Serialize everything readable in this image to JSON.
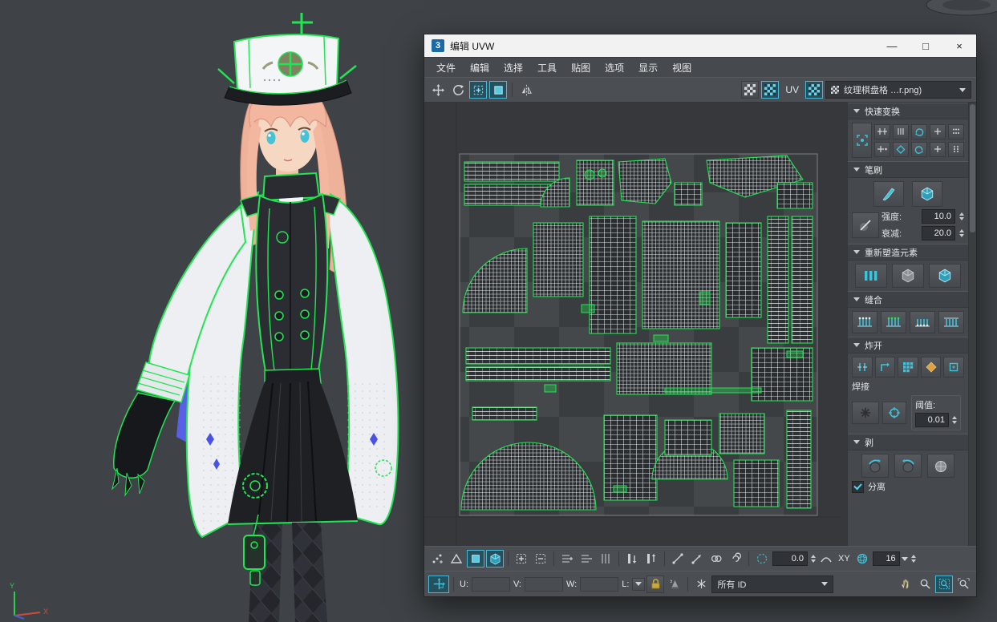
{
  "window": {
    "icon_label": "3",
    "title": "编辑 UVW",
    "minimize": "—",
    "maximize": "□",
    "close": "×"
  },
  "menubar": {
    "items": [
      "文件",
      "编辑",
      "选择",
      "工具",
      "贴图",
      "选项",
      "显示",
      "视图"
    ]
  },
  "toolbar": {
    "uv_label": "UV",
    "texture_name": "纹理棋盘格 …r.png)"
  },
  "panel": {
    "quick_transform": {
      "title": "快速变换"
    },
    "brush": {
      "title": "笔刷",
      "strength_label": "强度:",
      "strength_value": "10.0",
      "falloff_label": "衰减:",
      "falloff_value": "20.0"
    },
    "reshape": {
      "title": "重新塑造元素"
    },
    "stitch": {
      "title": "缝合"
    },
    "explode": {
      "title": "炸开",
      "weld_label": "焊接",
      "threshold_label": "阈值:",
      "threshold_value": "0.01"
    },
    "peel": {
      "title": "剥",
      "separate_label": "分离"
    }
  },
  "bottombar": {
    "angle_value": "0.0",
    "xy_label": "XY",
    "grid_value": "16",
    "u_label": "U:",
    "v_label": "V:",
    "w_label": "W:",
    "l_label": "L:",
    "id_filter": "所有 ID"
  },
  "axis": {
    "x_label": "X",
    "y_label": "Y"
  },
  "colors": {
    "accent_teal": "#3fc3da",
    "selection_green": "#22e552"
  }
}
